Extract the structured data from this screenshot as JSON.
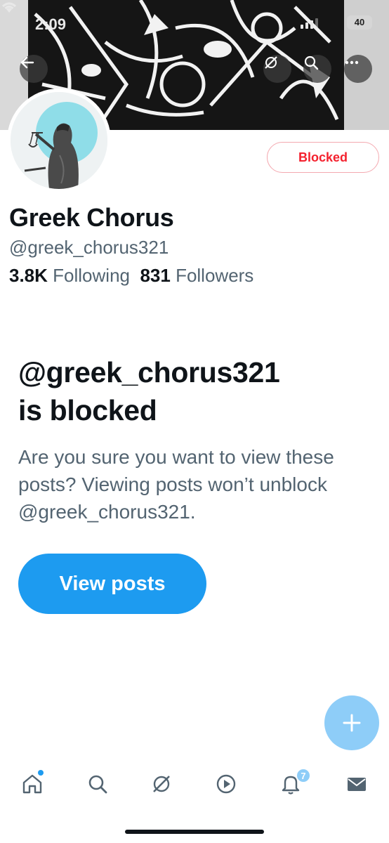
{
  "status_bar": {
    "time": "2:09",
    "battery": "40"
  },
  "header": {
    "back_icon": "back-arrow-icon",
    "actions": [
      "grok-icon",
      "search-icon",
      "more-icon"
    ]
  },
  "profile": {
    "blocked_label": "Blocked",
    "display_name": "Greek Chorus",
    "handle": "@greek_chorus321",
    "following_count": "3.8K",
    "following_label": "Following",
    "followers_count": "831",
    "followers_label": "Followers"
  },
  "blocked_notice": {
    "title_line1": "@greek_chorus321",
    "title_line2": "is blocked",
    "description": "Are you sure you want to view these posts? Viewing posts won’t unblock @greek_chorus321.",
    "view_button": "View posts"
  },
  "fab": {
    "icon": "plus-icon"
  },
  "tabbar": {
    "tabs": [
      "home-icon",
      "search-icon",
      "grok-icon",
      "video-icon",
      "notifications-icon",
      "messages-icon"
    ],
    "notifications_badge": "7"
  },
  "colors": {
    "accent": "#1d9bf0",
    "blocked_red": "#f4212e",
    "secondary_text": "#536471",
    "primary_text": "#0f1419"
  }
}
